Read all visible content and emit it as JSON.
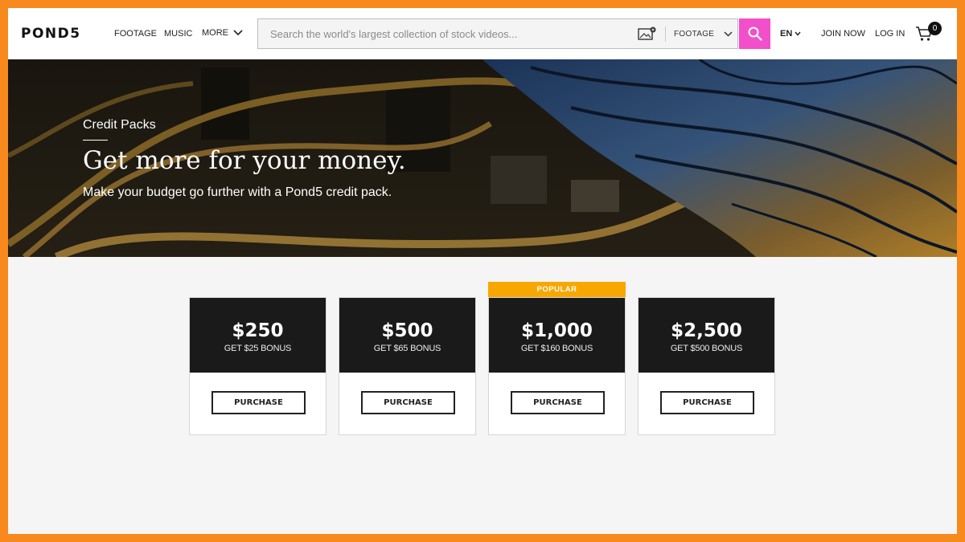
{
  "header": {
    "logo": "POND5",
    "nav": {
      "footage": "FOOTAGE",
      "music": "MUSIC",
      "more": "MORE"
    },
    "search": {
      "placeholder": "Search the world's largest collection of stock videos...",
      "type": "FOOTAGE"
    },
    "lang": "EN",
    "join": "JOIN NOW",
    "login": "LOG IN",
    "cart_count": "0"
  },
  "hero": {
    "eyebrow": "Credit Packs",
    "title": "Get more for your money.",
    "subtitle": "Make your budget go further with a Pond5 credit pack."
  },
  "packs": [
    {
      "price": "$250",
      "bonus": "GET $25 BONUS",
      "button": "PURCHASE"
    },
    {
      "price": "$500",
      "bonus": "GET $65 BONUS",
      "button": "PURCHASE"
    },
    {
      "price": "$1,000",
      "bonus": "GET $160 BONUS",
      "button": "PURCHASE",
      "badge": "POPULAR"
    },
    {
      "price": "$2,500",
      "bonus": "GET $500 BONUS",
      "button": "PURCHASE"
    }
  ],
  "colors": {
    "accent_pink": "#f24fca",
    "popular_orange": "#f7a700",
    "frame_orange": "#f7891d",
    "card_dark": "#1a1a1a"
  }
}
